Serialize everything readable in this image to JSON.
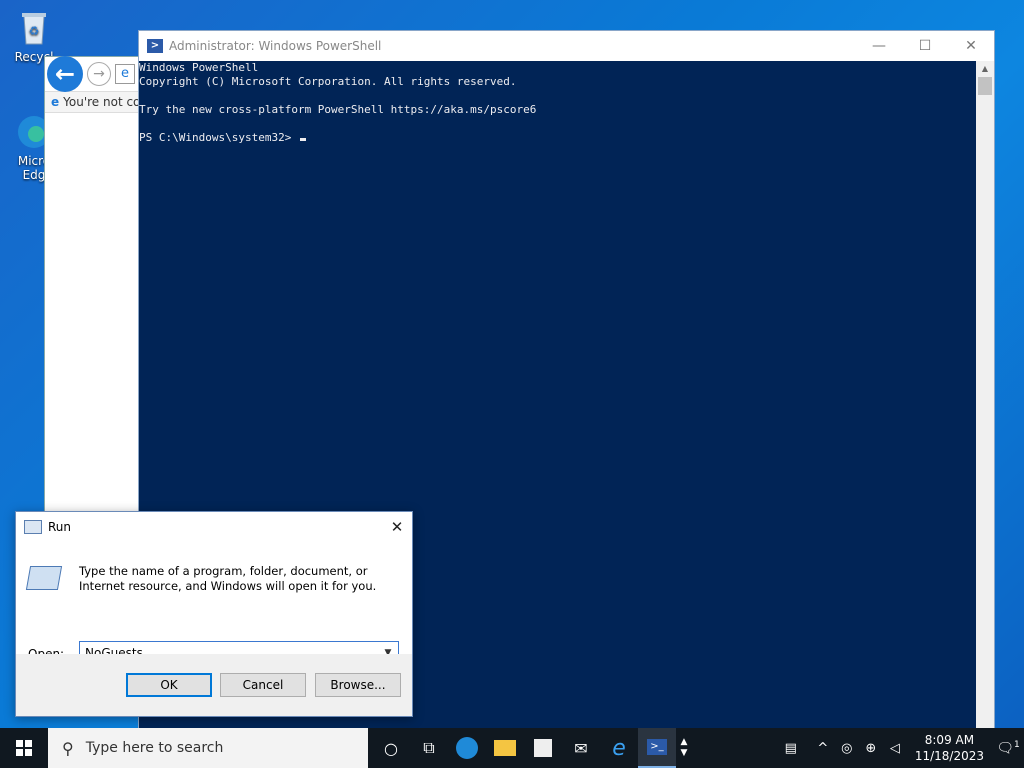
{
  "desktop": {
    "icons": [
      {
        "label": "Recycl",
        "icon": "recycle-bin-icon"
      },
      {
        "label": "Micro Edg",
        "icon": "edge-icon"
      }
    ]
  },
  "ie": {
    "tab_label": "You're not co",
    "back_icon": "back-arrow-icon",
    "forward_icon": "forward-arrow-icon"
  },
  "powershell": {
    "title": "Administrator: Windows PowerShell",
    "lines": [
      "Windows PowerShell",
      "Copyright (C) Microsoft Corporation. All rights reserved.",
      "",
      "Try the new cross-platform PowerShell https://aka.ms/pscore6",
      "",
      "PS C:\\Windows\\system32> "
    ],
    "bg_color": "#012456"
  },
  "run": {
    "title": "Run",
    "description": "Type the name of a program, folder, document, or Internet resource, and Windows will open it for you.",
    "open_label": "Open:",
    "open_value": "NoGuests",
    "ok_label": "OK",
    "cancel_label": "Cancel",
    "browse_label": "Browse..."
  },
  "taskbar": {
    "search_placeholder": "Type here to search",
    "time": "8:09 AM",
    "date": "11/18/2023",
    "notification_count": "1"
  }
}
